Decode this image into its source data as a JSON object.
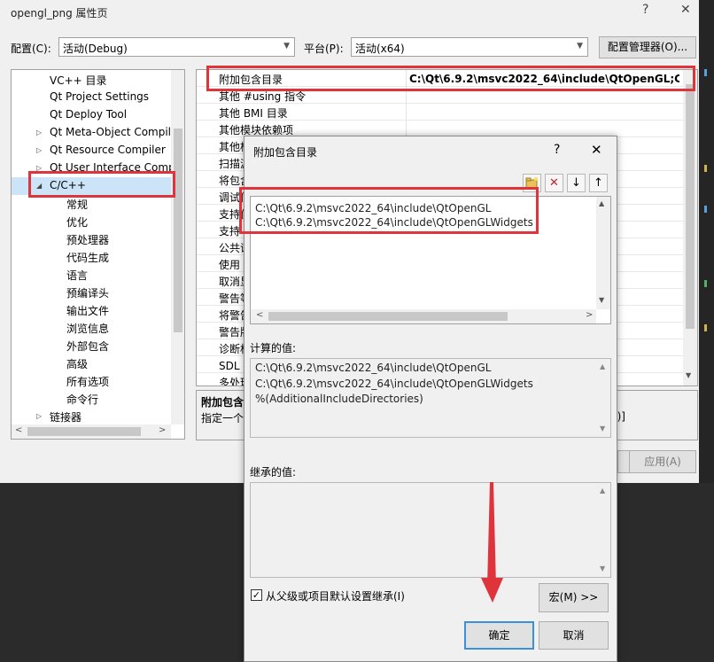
{
  "window": {
    "title": "opengl_png 属性页",
    "help_glyph": "?",
    "close_glyph": "✕"
  },
  "config_bar": {
    "config_label": "配置(C):",
    "config_value": "活动(Debug)",
    "platform_label": "平台(P):",
    "platform_value": "活动(x64)",
    "manager_button": "配置管理器(O)..."
  },
  "tree": {
    "items": [
      {
        "label": "VC++ 目录"
      },
      {
        "label": "Qt Project Settings"
      },
      {
        "label": "Qt Deploy Tool"
      },
      {
        "label": "Qt Meta-Object Compil",
        "arrow": "▷"
      },
      {
        "label": "Qt Resource Compiler",
        "arrow": "▷"
      },
      {
        "label": "Qt User Interface Comp",
        "arrow": "▷"
      },
      {
        "label": "C/C++",
        "arrow": "◢",
        "selected": true
      },
      {
        "label": "常规"
      },
      {
        "label": "优化"
      },
      {
        "label": "预处理器"
      },
      {
        "label": "代码生成"
      },
      {
        "label": "语言"
      },
      {
        "label": "预编译头"
      },
      {
        "label": "输出文件"
      },
      {
        "label": "浏览信息"
      },
      {
        "label": "外部包含"
      },
      {
        "label": "高级"
      },
      {
        "label": "所有选项"
      },
      {
        "label": "命令行"
      },
      {
        "label": "链接器",
        "arrow": "▷"
      }
    ]
  },
  "grid": {
    "rows": [
      {
        "name": "附加包含目录",
        "value": "C:\\Qt\\6.9.2\\msvc2022_64\\include\\QtOpenGL;C:\\Qt\\"
      },
      {
        "name": "其他 #using 指令"
      },
      {
        "name": "其他 BMI 目录"
      },
      {
        "name": "其他模块依赖项"
      },
      {
        "name": "其他桥"
      },
      {
        "name": "扫描源"
      },
      {
        "name": "将包含"
      },
      {
        "name": "调试信"
      },
      {
        "name": "支持仅"
      },
      {
        "name": "支持"
      },
      {
        "name": "公共语"
      },
      {
        "name": "使用"
      },
      {
        "name": "取消显"
      },
      {
        "name": "警告等"
      },
      {
        "name": "将警告"
      },
      {
        "name": "警告版"
      },
      {
        "name": "诊断格"
      },
      {
        "name": "SDL 检"
      },
      {
        "name": "多处理"
      }
    ],
    "desc_title": "附加包含",
    "desc_text": "指定一个",
    "desc_suffix": "n)]"
  },
  "footer": {
    "apply_button": "应用(A)"
  },
  "dialog": {
    "title": "附加包含目录",
    "help_glyph": "?",
    "close_glyph": "✕",
    "toolbar": {
      "new_icon": "new-folder-icon",
      "delete_glyph": "✕",
      "down_glyph": "↓",
      "up_glyph": "↑"
    },
    "entries": [
      "C:\\Qt\\6.9.2\\msvc2022_64\\include\\QtOpenGL",
      "C:\\Qt\\6.9.2\\msvc2022_64\\include\\QtOpenGLWidgets"
    ],
    "computed_label": "计算的值:",
    "computed": [
      "C:\\Qt\\6.9.2\\msvc2022_64\\include\\QtOpenGL",
      "C:\\Qt\\6.9.2\\msvc2022_64\\include\\QtOpenGLWidgets",
      "%(AdditionalIncludeDirectories)"
    ],
    "inherited_label": "继承的值:",
    "inherit_checkbox": "从父级或项目默认设置继承(I)",
    "inherit_checked": true,
    "macro_button": "宏(M) >>",
    "ok_button": "确定",
    "cancel_button": "取消"
  },
  "colors": {
    "highlight": "#e0343c",
    "selection": "#cce4f7"
  }
}
